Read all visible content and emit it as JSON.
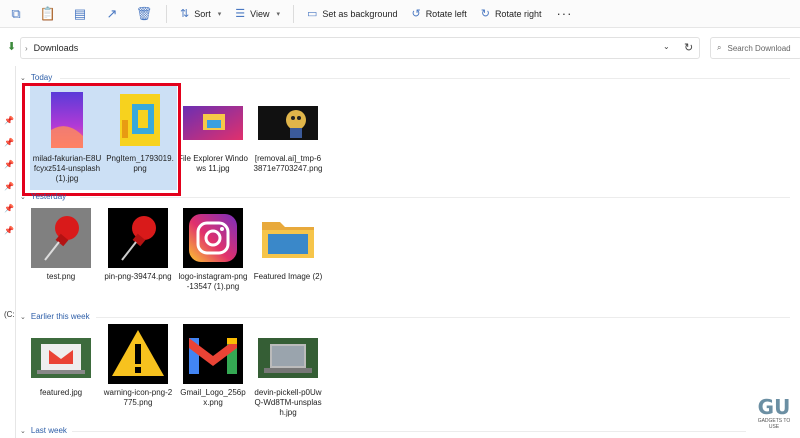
{
  "toolbar": {
    "sort": "Sort",
    "view": "View",
    "set_background": "Set as background",
    "rotate_left": "Rotate left",
    "rotate_right": "Rotate right",
    "more": "···"
  },
  "address": {
    "crumb": "Downloads",
    "search_placeholder": "Search Download"
  },
  "left_nav": {
    "drive_label": "(C:"
  },
  "groups": {
    "today": "Today",
    "yesterday": "Yesterday",
    "earlier_week": "Earlier this week",
    "last_week": "Last week"
  },
  "files": {
    "today": [
      {
        "name": "milad-fakurian-E8Ufcyxz514-unsplash (1).jpg"
      },
      {
        "name": "PngItem_1793019.png"
      },
      {
        "name": "File Explorer Windows 11.jpg"
      },
      {
        "name": "[removal.ai]_tmp-63871e7703247.png"
      }
    ],
    "yesterday": [
      {
        "name": "test.png"
      },
      {
        "name": "pin-png-39474.png"
      },
      {
        "name": "logo-instagram-png-13547 (1).png"
      },
      {
        "name": "Featured Image (2)"
      }
    ],
    "earlier": [
      {
        "name": "featured.jpg"
      },
      {
        "name": "warning-icon-png-2775.png"
      },
      {
        "name": "Gmail_Logo_256px.png"
      },
      {
        "name": "devin-pickell-p0UwQ-Wd8TM-unsplash.jpg"
      }
    ]
  },
  "watermark": {
    "big": "GU",
    "small": "GADGETS TO USE"
  },
  "colors": {
    "accent": "#2d5ea8",
    "selection": "#cce0f5",
    "highlight": "#e3001b"
  }
}
